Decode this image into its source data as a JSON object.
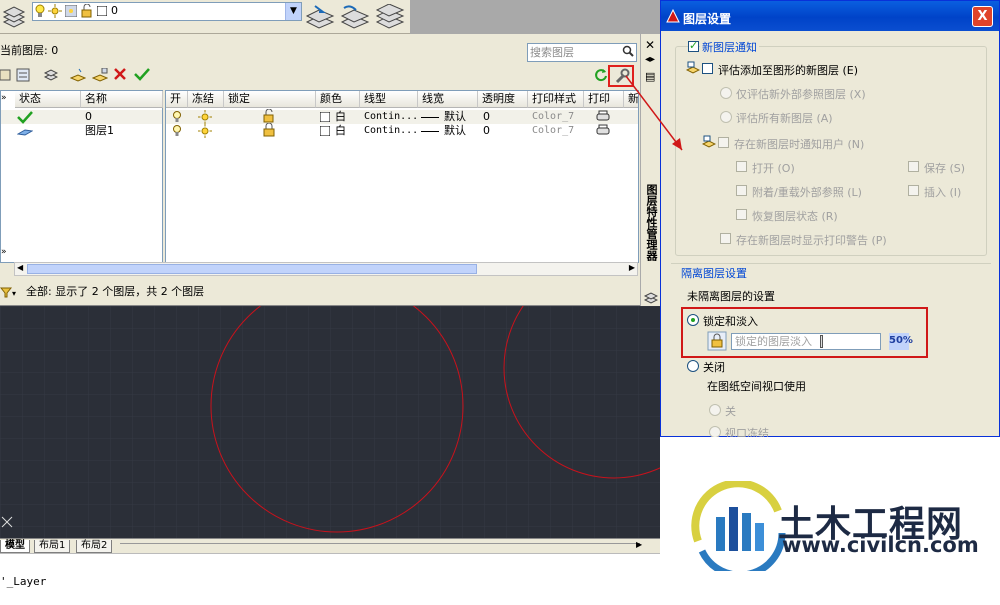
{
  "toolbar": {
    "layer_combo_value": "0"
  },
  "palette": {
    "current_layer_label": "当前图层: 0",
    "search_placeholder": "搜索图层",
    "side_title": "图层特性管理器",
    "tree_columns": [
      "状态",
      "名称"
    ],
    "columns": [
      "开",
      "冻结",
      "锁定",
      "颜色",
      "线型",
      "线宽",
      "透明度",
      "打印样式",
      "打印",
      "新"
    ],
    "rows": [
      {
        "name": "0",
        "color": "白",
        "linetype": "Contin...",
        "lineweight": "默认",
        "transparency": "0",
        "plot_style": "Color_7"
      },
      {
        "name": "图层1",
        "color": "白",
        "linetype": "Contin...",
        "lineweight": "默认",
        "transparency": "0",
        "plot_style": "Color_7"
      }
    ],
    "status_text": "全部: 显示了 2 个图层，共 2 个图层"
  },
  "layout_tabs": [
    "模型",
    "布局1",
    "布局2"
  ],
  "command_line": "'_Layer",
  "dialog": {
    "title": "图层设置",
    "close_label": "X",
    "new_layer_group": "新图层通知",
    "evaluate_new": "评估添加至图形的新图层 (E)",
    "eval_xref_only": "仅评估新外部参照图层 (X)",
    "eval_all": "评估所有新图层 (A)",
    "notify_when_new": "存在新图层时通知用户 (N)",
    "open": "打开 (O)",
    "save": "保存 (S)",
    "attach_reload": "附着/重载外部参照 (L)",
    "insert": "插入 (I)",
    "restore_state": "恢复图层状态 (R)",
    "plot_warning": "存在新图层时显示打印警告 (P)",
    "isolate_group": "隔离图层设置",
    "unisolated_label": "未隔离图层的设置",
    "lock_and_fade": "锁定和淡入",
    "locked_fade_label": "锁定的图层淡入",
    "fade_value": "50%",
    "off": "关闭",
    "in_paper_space": "在图纸空间视口使用",
    "off_option": "关",
    "vp_freeze": "视口冻结"
  },
  "watermark": {
    "brand": "土木工程网",
    "url": "www.civilcn.com"
  },
  "colors": {
    "accent_red": "#d01818",
    "circle_red": "#c8121c",
    "brand_blue": "#1d4f9c"
  }
}
